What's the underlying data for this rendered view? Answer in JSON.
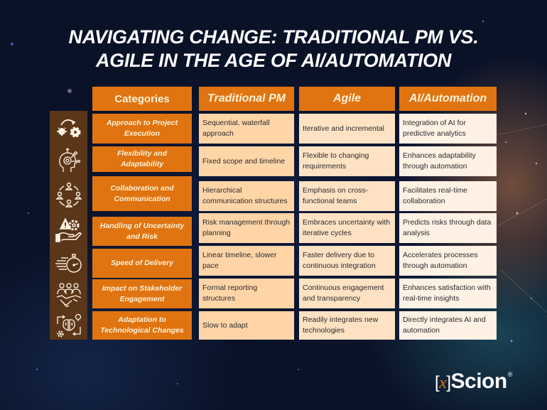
{
  "title": {
    "line1": "NAVIGATING CHANGE: TRADITIONAL PM VS.",
    "line2": "AGILE IN THE AGE OF AI/AUTOMATION"
  },
  "table": {
    "headers": [
      "Categories",
      "Traditional PM",
      "Agile",
      "AI/Automation"
    ],
    "rows": [
      {
        "icon": "idea-to-gear-icon",
        "category": "Approach to Project Execution",
        "traditional": "Sequential, waterfall approach",
        "agile": "Iterative and incremental",
        "ai": "Integration of AI for predictive analytics"
      },
      {
        "icon": "head-gear-icon",
        "category": "Flexibility and Adaptability",
        "traditional": "Fixed scope and timeline",
        "agile": "Flexible to changing requirements",
        "ai": "Enhances adaptability through automation"
      },
      {
        "icon": "team-circle-icon",
        "category": "Collaboration and Communication",
        "traditional": "Hierarchical communication structures",
        "agile": "Emphasis on cross-functional teams",
        "ai": "Facilitates real-time collaboration"
      },
      {
        "icon": "risk-hand-icon",
        "category": "Handling of Uncertainty and Risk",
        "traditional": "Risk management through planning",
        "agile": "Embraces uncertainty with iterative cycles",
        "ai": "Predicts risks through data analysis"
      },
      {
        "icon": "stopwatch-speed-icon",
        "category": "Speed of Delivery",
        "traditional": "Linear timeline, slower pace",
        "agile": "Faster delivery due to continuous integration",
        "ai": "Accelerates processes through automation"
      },
      {
        "icon": "handshake-people-icon",
        "category": "Impact on Stakeholder Engagement",
        "traditional": "Formal reporting structures",
        "agile": "Continuous engagement and transparency",
        "ai": "Enhances satisfaction with real-time insights"
      },
      {
        "icon": "brain-cycle-icon",
        "category": "Adaptation to Technological Changes",
        "traditional": "Slow to adapt",
        "agile": "Readily integrates new technologies",
        "ai": "Directly integrates AI and automation"
      }
    ]
  },
  "logo": {
    "bracket_open": "[",
    "x": "x",
    "bracket_close": "]",
    "name": "Scion",
    "reg": "®"
  },
  "colors": {
    "accent_orange": "#e07411",
    "icon_panel": "#5b3619",
    "traditional_bg": "#ffd5a8",
    "agile_bg": "#ffe2c4",
    "ai_bg": "#fff1e4",
    "background": "#0a1228"
  }
}
